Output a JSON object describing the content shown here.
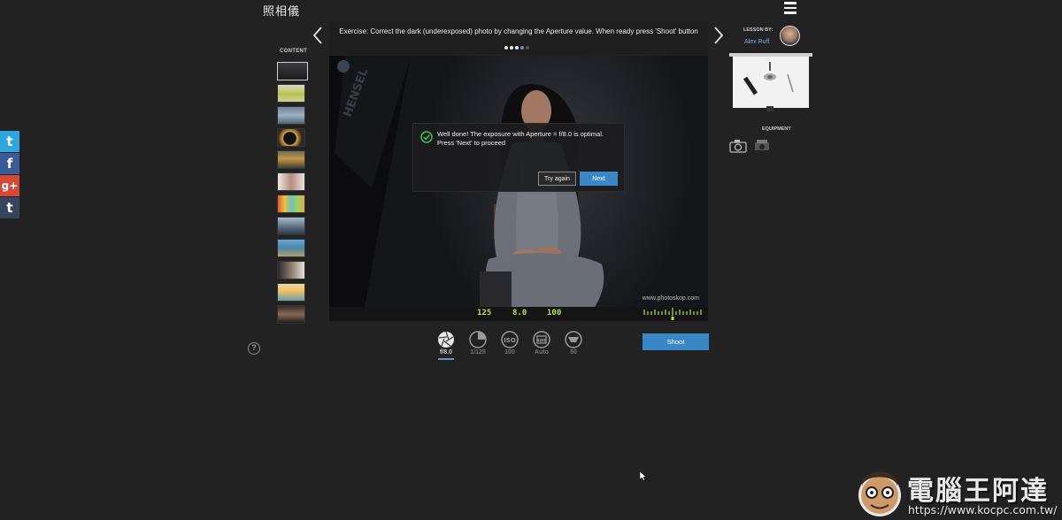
{
  "app": {
    "logo_text": "照相儀"
  },
  "social": [
    {
      "name": "twitter",
      "glyph": "t",
      "color": "#2fa7de"
    },
    {
      "name": "facebook",
      "glyph": "f",
      "color": "#3a5a98"
    },
    {
      "name": "google-plus",
      "glyph": "g+",
      "color": "#d34836"
    },
    {
      "name": "tumblr",
      "glyph": "t",
      "color": "#35465c"
    }
  ],
  "sidebar": {
    "content_label": "CONTENT",
    "thumbnails": [
      {
        "subject": "portrait woman",
        "active": true
      },
      {
        "subject": "cupcakes"
      },
      {
        "subject": "lake landscape"
      },
      {
        "subject": "vinyl record"
      },
      {
        "subject": "mountain sunset"
      },
      {
        "subject": "woman portrait"
      },
      {
        "subject": "colored pencils"
      },
      {
        "subject": "city skyline"
      },
      {
        "subject": "coastal town"
      },
      {
        "subject": "woman studio"
      },
      {
        "subject": "beach sunrise"
      },
      {
        "subject": "portrait dark"
      }
    ]
  },
  "exercise": {
    "text": "Exercise: Correct the dark (underexposed) photo by changing the Aperture value. When ready press 'Shoot' button",
    "progress_dots": 5,
    "current_dot": 4
  },
  "photo": {
    "watermark": "www.photoskop.com"
  },
  "dialog": {
    "message": "Well done! The exposure with Aperture = f/8.0 is optimal. Press 'Next' to proceed",
    "try_again_label": "Try again",
    "next_label": "Next"
  },
  "readout": {
    "shutter": "125",
    "aperture": "8.0",
    "iso": "100"
  },
  "controls": [
    {
      "id": "aperture",
      "label": "f/8.0",
      "icon": "aperture-icon",
      "active": true
    },
    {
      "id": "shutter",
      "label": "1/125",
      "icon": "shutter-speed-icon"
    },
    {
      "id": "iso",
      "label": "100",
      "icon": "iso-icon"
    },
    {
      "id": "white-balance",
      "label": "Auto",
      "icon": "white-balance-icon"
    },
    {
      "id": "focal-length",
      "label": "50",
      "icon": "lens-icon"
    }
  ],
  "shoot_label": "Shoot",
  "lesson": {
    "by_label": "LESSON BY:",
    "author": "Alex Ruff"
  },
  "equipment_label": "EQUIPMENT",
  "site_logo": {
    "name": "電腦王阿達",
    "url": "https://www.kocpc.com.tw/"
  },
  "colors": {
    "accent": "#3a87c8",
    "highlight": "#6d8fc4",
    "lcd": "#b5e04a",
    "success": "#44c552"
  }
}
